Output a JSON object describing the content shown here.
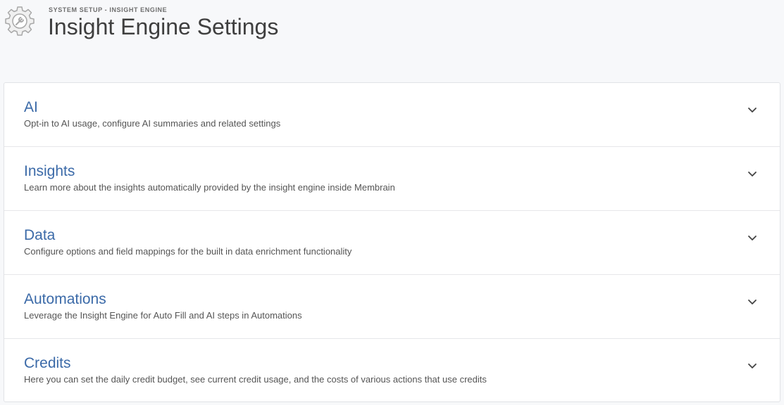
{
  "header": {
    "breadcrumb": "SYSTEM SETUP - INSIGHT ENGINE",
    "title": "Insight Engine Settings",
    "icon": "gear-wrench-icon"
  },
  "sections": [
    {
      "title": "AI",
      "description": "Opt-in to AI usage, configure AI summaries and related settings"
    },
    {
      "title": "Insights",
      "description": "Learn more about the insights automatically provided by the insight engine inside Membrain"
    },
    {
      "title": "Data",
      "description": "Configure options and field mappings for the built in data enrichment functionality"
    },
    {
      "title": "Automations",
      "description": "Leverage the Insight Engine for Auto Fill and AI steps in Automations"
    },
    {
      "title": "Credits",
      "description": "Here you can set the daily credit budget, see current credit usage, and the costs of various actions that use credits"
    }
  ],
  "colors": {
    "accent": "#3b6aa8",
    "background": "#f7f8fa"
  }
}
